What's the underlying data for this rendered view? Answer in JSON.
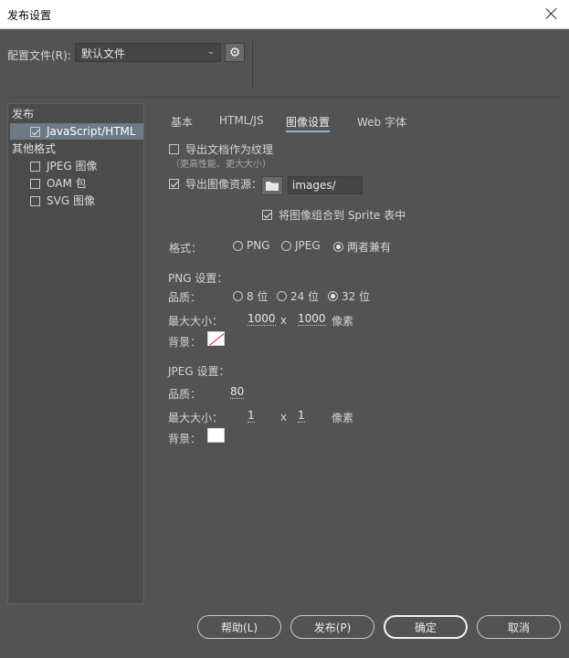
{
  "window": {
    "title": "发布设置"
  },
  "profile": {
    "label": "配置文件(R):",
    "value": "默认文件"
  },
  "sidebar": {
    "publish_label": "发布",
    "publish_items": [
      {
        "label": "JavaScript/HTML",
        "checked": true
      }
    ],
    "other_label": "其他格式",
    "other_items": [
      {
        "label": "JPEG 图像",
        "checked": false
      },
      {
        "label": "OAM 包",
        "checked": false
      },
      {
        "label": "SVG 图像",
        "checked": false
      }
    ]
  },
  "tabs": [
    "基本",
    "HTML/JS",
    "图像设置",
    "Web 字体"
  ],
  "active_tab": "图像设置",
  "export_texture": {
    "label": "导出文档作为纹理",
    "hint": "（更高性能、更大大小）",
    "checked": false
  },
  "export_assets": {
    "label": "导出图像资源：",
    "checked": true,
    "path": "images/"
  },
  "sprite": {
    "label": "将图像组合到 Sprite 表中",
    "checked": true
  },
  "format": {
    "label": "格式：",
    "options": [
      "PNG",
      "JPEG",
      "两者兼有"
    ],
    "selected": "两者兼有"
  },
  "png": {
    "heading": "PNG 设置：",
    "quality_label": "品质：",
    "quality_options": [
      "8 位",
      "24 位",
      "32 位"
    ],
    "quality_selected": "32 位",
    "max_size_label": "最大大小：",
    "width": "1000",
    "x": "x",
    "height": "1000",
    "unit": "像素",
    "bg_label": "背景：",
    "bg_color": "none"
  },
  "jpeg": {
    "heading": "JPEG 设置：",
    "quality_label": "品质：",
    "quality": "80",
    "max_size_label": "最大大小：",
    "width": "1",
    "x": "x",
    "height": "1",
    "unit": "像素",
    "bg_label": "背景：",
    "bg_color": "#ffffff"
  },
  "buttons": {
    "help": "帮助(L)",
    "publish": "发布(P)",
    "ok": "确定",
    "cancel": "取消"
  },
  "colors": {
    "panel": "#535353",
    "accent": "#8fb5d8",
    "selection": "#6d7a86"
  }
}
